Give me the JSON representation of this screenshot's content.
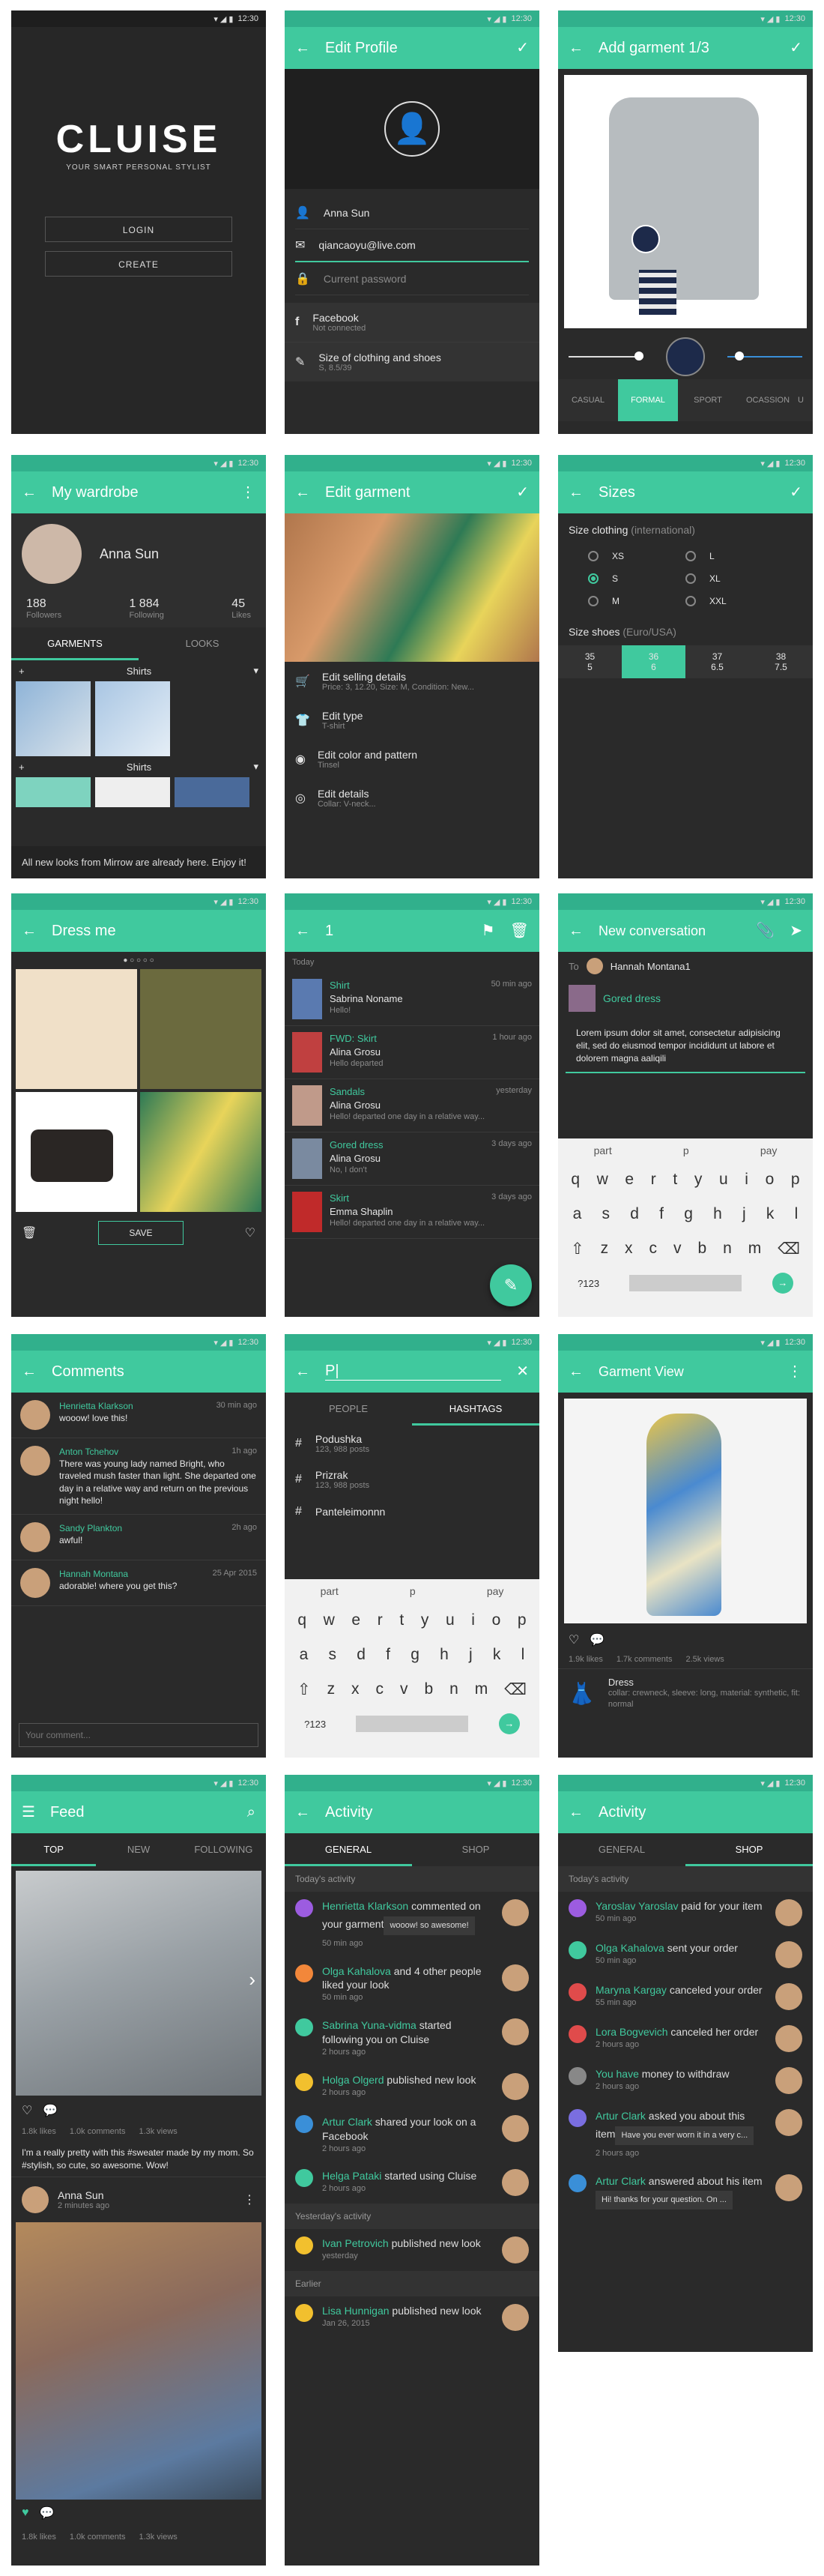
{
  "status": {
    "time": "12:30"
  },
  "s1": {
    "logo": "CLUISE",
    "tagline": "YOUR SMART PERSONAL STYLIST",
    "login": "LOGIN",
    "create": "CREATE"
  },
  "s2": {
    "title": "Edit Profile",
    "name": "Anna Sun",
    "email": "qiancaoyu@live.com",
    "password_ph": "Current password",
    "fb": "Facebook",
    "fb_sub": "Not connected",
    "size": "Size of clothing and shoes",
    "size_sub": "S, 8.5/39"
  },
  "s3": {
    "title": "Add garment 1/3",
    "tabs": [
      "CASUAL",
      "FORMAL",
      "SPORT",
      "OCASSION",
      "U"
    ]
  },
  "s4": {
    "title": "My wardrobe",
    "name": "Anna Sun",
    "stats": [
      {
        "n": "188",
        "l": "Followers"
      },
      {
        "n": "1 884",
        "l": "Following"
      },
      {
        "n": "45",
        "l": "Likes"
      }
    ],
    "tabs": [
      "GARMENTS",
      "LOOKS"
    ],
    "cat1": "Shirts",
    "cat2": "Shirts",
    "toast": "All new looks from Mirrow are already here. Enjoy it!"
  },
  "s5": {
    "title": "Edit garment",
    "items": [
      {
        "t": "Edit selling details",
        "s": "Price: 3, 12.20, Size: M, Condition: New..."
      },
      {
        "t": "Edit type",
        "s": "T-shirt"
      },
      {
        "t": "Edit color and pattern",
        "s": "Tinsel"
      },
      {
        "t": "Edit details",
        "s": "Collar: V-neck..."
      }
    ]
  },
  "s6": {
    "title": "Sizes",
    "clothing_label": "Size clothing",
    "clothing_note": "(international)",
    "sizes": [
      "XS",
      "L",
      "S",
      "XL",
      "M",
      "XXL"
    ],
    "shoes_label": "Size shoes",
    "shoes_note": "(Euro/USA)",
    "shoes": [
      {
        "e": "35",
        "u": "5"
      },
      {
        "e": "36",
        "u": "6"
      },
      {
        "e": "37",
        "u": "6.5"
      },
      {
        "e": "38",
        "u": "7.5"
      }
    ]
  },
  "s7": {
    "title": "Dress me",
    "save": "SAVE"
  },
  "s8": {
    "title": "1",
    "today": "Today",
    "msgs": [
      {
        "item": "Shirt",
        "name": "Sabrina Noname",
        "text": "Hello!",
        "time": "50 min ago"
      },
      {
        "item": "FWD: Skirt",
        "name": "Alina Grosu",
        "text": "Hello departed",
        "time": "1 hour ago"
      },
      {
        "item": "Sandals",
        "name": "Alina Grosu",
        "text": "Hello! departed one day in a relative way...",
        "time": "yesterday"
      },
      {
        "item": "Gored dress",
        "name": "Alina Grosu",
        "text": "No, I don't",
        "time": "3 days ago"
      },
      {
        "item": "Skirt",
        "name": "Emma Shaplin",
        "text": "Hello! departed one day in a relative way...",
        "time": "3 days ago"
      }
    ]
  },
  "s9": {
    "title": "New conversation",
    "to_label": "To",
    "to_name": "Hannah Montana1",
    "item": "Gored dress",
    "body": "Lorem ipsum dolor sit amet, consectetur adipisicing elit, sed do eiusmod tempor incididunt ut labore et dolorem magna aaliqili",
    "sugg": [
      "part",
      "p",
      "pay"
    ],
    "num": "?123"
  },
  "s10": {
    "title": "Comments",
    "comments": [
      {
        "name": "Henrietta Klarkson",
        "text": "wooow! love this!",
        "time": "30 min ago"
      },
      {
        "name": "Anton Tchehov",
        "text": "There was young lady named Bright, who traveled mush faster than light. She departed one day in a relative way and return on the previous night hello!",
        "time": "1h ago"
      },
      {
        "name": "Sandy Plankton",
        "text": "awful!",
        "time": "2h ago"
      },
      {
        "name": "Hannah Montana",
        "text": "adorable! where you get this?",
        "time": "25 Apr 2015"
      }
    ],
    "input_ph": "Your comment..."
  },
  "s11": {
    "query": "P|",
    "tabs": [
      "PEOPLE",
      "HASHTAGS"
    ],
    "results": [
      {
        "t": "Podushka",
        "s": "123, 988 posts"
      },
      {
        "t": "Prizrak",
        "s": "123, 988 posts"
      },
      {
        "t": "Panteleimonnn",
        "s": ""
      }
    ],
    "sugg": [
      "part",
      "p",
      "pay"
    ],
    "num": "?123"
  },
  "s12": {
    "title": "Garment View",
    "likes": "1.9k likes",
    "comments": "1.7k comments",
    "views": "2.5k views",
    "type": "Dress",
    "details": "collar: crewneck, sleeve: long, material: synthetic, fit: normal"
  },
  "s13": {
    "title": "Feed",
    "tabs": [
      "TOP",
      "NEW",
      "FOLLOWING"
    ],
    "likes": "1.8k likes",
    "comments": "1.0k comments",
    "views": "1.3k views",
    "caption": "I'm a really pretty with this #sweater made by my mom. So #stylish, so cute, so awesome. Wow!",
    "user": "Anna Sun",
    "ago": "2 minutes ago",
    "likes2": "1.8k likes",
    "comments2": "1.0k comments",
    "views2": "1.3k views"
  },
  "s14": {
    "title": "Activity",
    "tabs": [
      "GENERAL",
      "SHOP"
    ],
    "today": "Today's activity",
    "items": [
      {
        "name": "Henrietta Klarkson",
        "text": "commented on your garment",
        "quote": "wooow! so awesome!",
        "time": "50 min ago",
        "color": "#9c5ce0"
      },
      {
        "name": "Olga Kahalova",
        "text": "and 4 other people liked your look",
        "time": "50 min ago",
        "color": "#f2873a"
      },
      {
        "name": "Sabrina Yuna-vidma",
        "text": "started following you on Cluise",
        "time": "2 hours ago",
        "color": "#40c99e"
      },
      {
        "name": "Holga Olgerd",
        "text": "published new look",
        "time": "2 hours ago",
        "color": "#f2c02e"
      },
      {
        "name": "Artur Clark",
        "text": "shared your look on a Facebook",
        "time": "2 hours ago",
        "color": "#3a8fd8"
      },
      {
        "name": "Helga Pataki",
        "text": "started using Cluise",
        "time": "2 hours ago",
        "color": "#40c99e"
      }
    ],
    "yesterday": "Yesterday's activity",
    "y_items": [
      {
        "name": "Ivan Petrovich",
        "text": "published new look",
        "time": "yesterday",
        "color": "#f2c02e"
      }
    ],
    "earlier": "Earlier",
    "e_items": [
      {
        "name": "Lisa Hunnigan",
        "text": "published new look",
        "time": "Jan 26, 2015",
        "color": "#f2c02e"
      }
    ]
  },
  "s15": {
    "title": "Activity",
    "tabs": [
      "GENERAL",
      "SHOP"
    ],
    "today": "Today's activity",
    "items": [
      {
        "name": "Yaroslav Yaroslav",
        "text": "paid for your item",
        "time": "50 min ago",
        "color": "#9c5ce0"
      },
      {
        "name": "Olga Kahalova",
        "text": "sent your order",
        "time": "50 min ago",
        "color": "#40c99e"
      },
      {
        "name": "Maryna Kargay",
        "text": "canceled your order",
        "time": "55 min ago",
        "color": "#e04b4b"
      },
      {
        "name": "Lora Bogvevich",
        "text": "canceled her order",
        "time": "2 hours ago",
        "color": "#e04b4b"
      },
      {
        "name": "You have",
        "text": "money to withdraw",
        "time": "2 hours ago",
        "color": "#888"
      },
      {
        "name": "Artur Clark",
        "text": "asked you about this item",
        "quote": "Have you ever worn it in a very c...",
        "time": "2 hours ago",
        "color": "#7a6ee0"
      },
      {
        "name": "Artur Clark",
        "text": "answered about his item",
        "quote": "Hi! thanks for your question. On ...",
        "time": "",
        "color": "#3a8fd8"
      }
    ]
  }
}
